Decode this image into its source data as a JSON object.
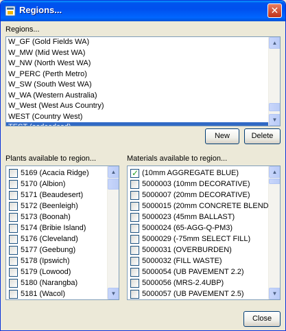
{
  "window": {
    "title": "Regions...",
    "close_symbol": "✕"
  },
  "regions": {
    "label": "Regions...",
    "items": [
      {
        "label": "W_GF (Gold Fields WA)",
        "selected": false
      },
      {
        "label": "W_MW (Mid West WA)",
        "selected": false
      },
      {
        "label": "W_NW (North West WA)",
        "selected": false
      },
      {
        "label": "W_PERC (Perth Metro)",
        "selected": false
      },
      {
        "label": "W_SW (South West WA)",
        "selected": false
      },
      {
        "label": "W_WA (Western Australia)",
        "selected": false
      },
      {
        "label": "W_West (West Aus Country)",
        "selected": false
      },
      {
        "label": "WEST (Country West)",
        "selected": false
      },
      {
        "label": "TEST (asdasdasd)",
        "selected": true
      }
    ],
    "new_label": "New",
    "delete_label": "Delete"
  },
  "plants": {
    "label": "Plants available to region...",
    "items": [
      {
        "label": "5169 (Acacia Ridge)",
        "checked": false
      },
      {
        "label": "5170 (Albion)",
        "checked": false
      },
      {
        "label": "5171 (Beaudesert)",
        "checked": false
      },
      {
        "label": "5172 (Beenleigh)",
        "checked": false
      },
      {
        "label": "5173 (Boonah)",
        "checked": false
      },
      {
        "label": "5174 (Bribie Island)",
        "checked": false
      },
      {
        "label": "5176 (Cleveland)",
        "checked": false
      },
      {
        "label": "5177 (Geebung)",
        "checked": false
      },
      {
        "label": "5178 (Ipswich)",
        "checked": false
      },
      {
        "label": "5179 (Lowood)",
        "checked": false
      },
      {
        "label": "5180 (Narangba)",
        "checked": false
      },
      {
        "label": "5181 (Wacol)",
        "checked": false
      }
    ]
  },
  "materials": {
    "label": "Materials available to region...",
    "items": [
      {
        "label": "(10mm AGGREGATE BLUE)",
        "checked": true
      },
      {
        "label": "5000003 (10mm DECORATIVE)",
        "checked": false
      },
      {
        "label": "5000007 (20mm DECORATIVE)",
        "checked": false
      },
      {
        "label": "5000015 (20mm CONCRETE BLEND)",
        "checked": false
      },
      {
        "label": "5000023 (45mm BALLAST)",
        "checked": false
      },
      {
        "label": "5000024 (65-AGG-Q-PM3)",
        "checked": false
      },
      {
        "label": "5000029 (-75mm SELECT FILL)",
        "checked": false
      },
      {
        "label": "5000031 (OVERBURDEN)",
        "checked": false
      },
      {
        "label": "5000032 (FILL WASTE)",
        "checked": false
      },
      {
        "label": "5000054 (UB PAVEMENT 2.2)",
        "checked": false
      },
      {
        "label": "5000056 (MRS-2.4UBP)",
        "checked": false
      },
      {
        "label": "5000057 (UB PAVEMENT 2.5)",
        "checked": false
      }
    ]
  },
  "footer": {
    "close_label": "Close"
  },
  "colors": {
    "titlebar": "#0058ee",
    "selection": "#316ac5",
    "face": "#ece9d8"
  }
}
